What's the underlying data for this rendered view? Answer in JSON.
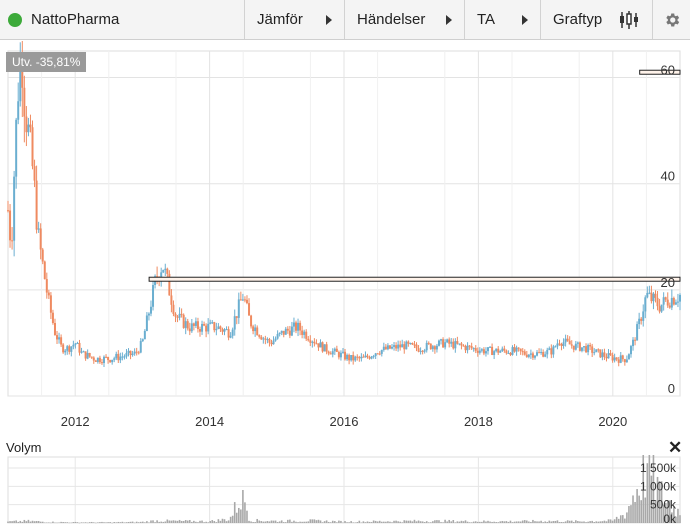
{
  "toolbar": {
    "instrument": "NattoPharma",
    "compare_label": "Jämför",
    "events_label": "Händelser",
    "ta_label": "TA",
    "charttype_label": "Graftyp",
    "status_color": "#3daa3a",
    "settings_icon": "gear-icon",
    "charttype_icon": "candlestick-icon"
  },
  "chart": {
    "change_label": "Utv. -35,81%",
    "y_ticks": [
      "60",
      "40",
      "20",
      "0"
    ],
    "x_ticks": [
      "2012",
      "2014",
      "2016",
      "2018",
      "2020"
    ],
    "colors": {
      "up": "#6aaed0",
      "down": "#ef8a60",
      "line": "#222222"
    }
  },
  "volume": {
    "label": "Volym",
    "close_label": "✕",
    "ticks": [
      "1 500k",
      "1 000k",
      "500k",
      "0k"
    ]
  },
  "chart_data": {
    "type": "line",
    "x_range": [
      2011.0,
      2021.0
    ],
    "ylim": [
      0,
      65
    ],
    "price_points": [
      [
        2011.0,
        35
      ],
      [
        2011.05,
        28
      ],
      [
        2011.1,
        45
      ],
      [
        2011.15,
        58
      ],
      [
        2011.2,
        66
      ],
      [
        2011.25,
        55
      ],
      [
        2011.3,
        50
      ],
      [
        2011.35,
        45
      ],
      [
        2011.4,
        38
      ],
      [
        2011.45,
        30
      ],
      [
        2011.5,
        26
      ],
      [
        2011.6,
        18
      ],
      [
        2011.7,
        12
      ],
      [
        2011.8,
        9
      ],
      [
        2011.9,
        9
      ],
      [
        2012.0,
        10
      ],
      [
        2012.1,
        8
      ],
      [
        2012.3,
        7
      ],
      [
        2012.5,
        7
      ],
      [
        2012.7,
        7.5
      ],
      [
        2012.9,
        8
      ],
      [
        2013.0,
        10
      ],
      [
        2013.1,
        16
      ],
      [
        2013.2,
        22
      ],
      [
        2013.3,
        25
      ],
      [
        2013.4,
        20
      ],
      [
        2013.5,
        15
      ],
      [
        2013.7,
        13
      ],
      [
        2013.9,
        13
      ],
      [
        2014.1,
        13
      ],
      [
        2014.3,
        12
      ],
      [
        2014.5,
        19
      ],
      [
        2014.6,
        14
      ],
      [
        2014.8,
        11
      ],
      [
        2014.9,
        10
      ],
      [
        2015.1,
        12
      ],
      [
        2015.3,
        13
      ],
      [
        2015.5,
        11
      ],
      [
        2015.7,
        9
      ],
      [
        2015.9,
        8
      ],
      [
        2016.1,
        7
      ],
      [
        2016.3,
        7
      ],
      [
        2016.5,
        8.5
      ],
      [
        2016.7,
        9
      ],
      [
        2016.9,
        9.5
      ],
      [
        2017.1,
        9
      ],
      [
        2017.3,
        9.5
      ],
      [
        2017.5,
        10
      ],
      [
        2017.7,
        9.5
      ],
      [
        2017.9,
        9
      ],
      [
        2018.1,
        8.5
      ],
      [
        2018.3,
        8.5
      ],
      [
        2018.5,
        8.5
      ],
      [
        2018.7,
        8
      ],
      [
        2018.9,
        8
      ],
      [
        2019.1,
        8.5
      ],
      [
        2019.2,
        10.5
      ],
      [
        2019.4,
        9.5
      ],
      [
        2019.6,
        9
      ],
      [
        2019.8,
        8
      ],
      [
        2019.9,
        7.5
      ],
      [
        2020.1,
        7
      ],
      [
        2020.2,
        7
      ],
      [
        2020.3,
        10
      ],
      [
        2020.4,
        14
      ],
      [
        2020.5,
        19
      ],
      [
        2020.6,
        18
      ],
      [
        2020.7,
        17
      ],
      [
        2020.8,
        18
      ],
      [
        2020.9,
        18.5
      ],
      [
        2021.0,
        19
      ]
    ],
    "reference_levels": [
      61,
      22
    ],
    "volume_points": [
      [
        2011.0,
        40
      ],
      [
        2011.3,
        60
      ],
      [
        2011.6,
        30
      ],
      [
        2012.0,
        20
      ],
      [
        2012.5,
        20
      ],
      [
        2013.0,
        30
      ],
      [
        2013.2,
        70
      ],
      [
        2013.5,
        60
      ],
      [
        2014.0,
        50
      ],
      [
        2014.3,
        120
      ],
      [
        2014.5,
        900
      ],
      [
        2014.6,
        80
      ],
      [
        2015.0,
        60
      ],
      [
        2015.5,
        70
      ],
      [
        2016.0,
        40
      ],
      [
        2016.5,
        50
      ],
      [
        2017.0,
        60
      ],
      [
        2017.5,
        60
      ],
      [
        2018.0,
        50
      ],
      [
        2018.5,
        50
      ],
      [
        2019.0,
        60
      ],
      [
        2019.5,
        50
      ],
      [
        2020.0,
        70
      ],
      [
        2020.2,
        300
      ],
      [
        2020.3,
        800
      ],
      [
        2020.4,
        1200
      ],
      [
        2020.5,
        1650
      ],
      [
        2020.6,
        1500
      ],
      [
        2020.7,
        900
      ],
      [
        2020.8,
        700
      ],
      [
        2020.9,
        500
      ],
      [
        2021.0,
        300
      ]
    ]
  }
}
